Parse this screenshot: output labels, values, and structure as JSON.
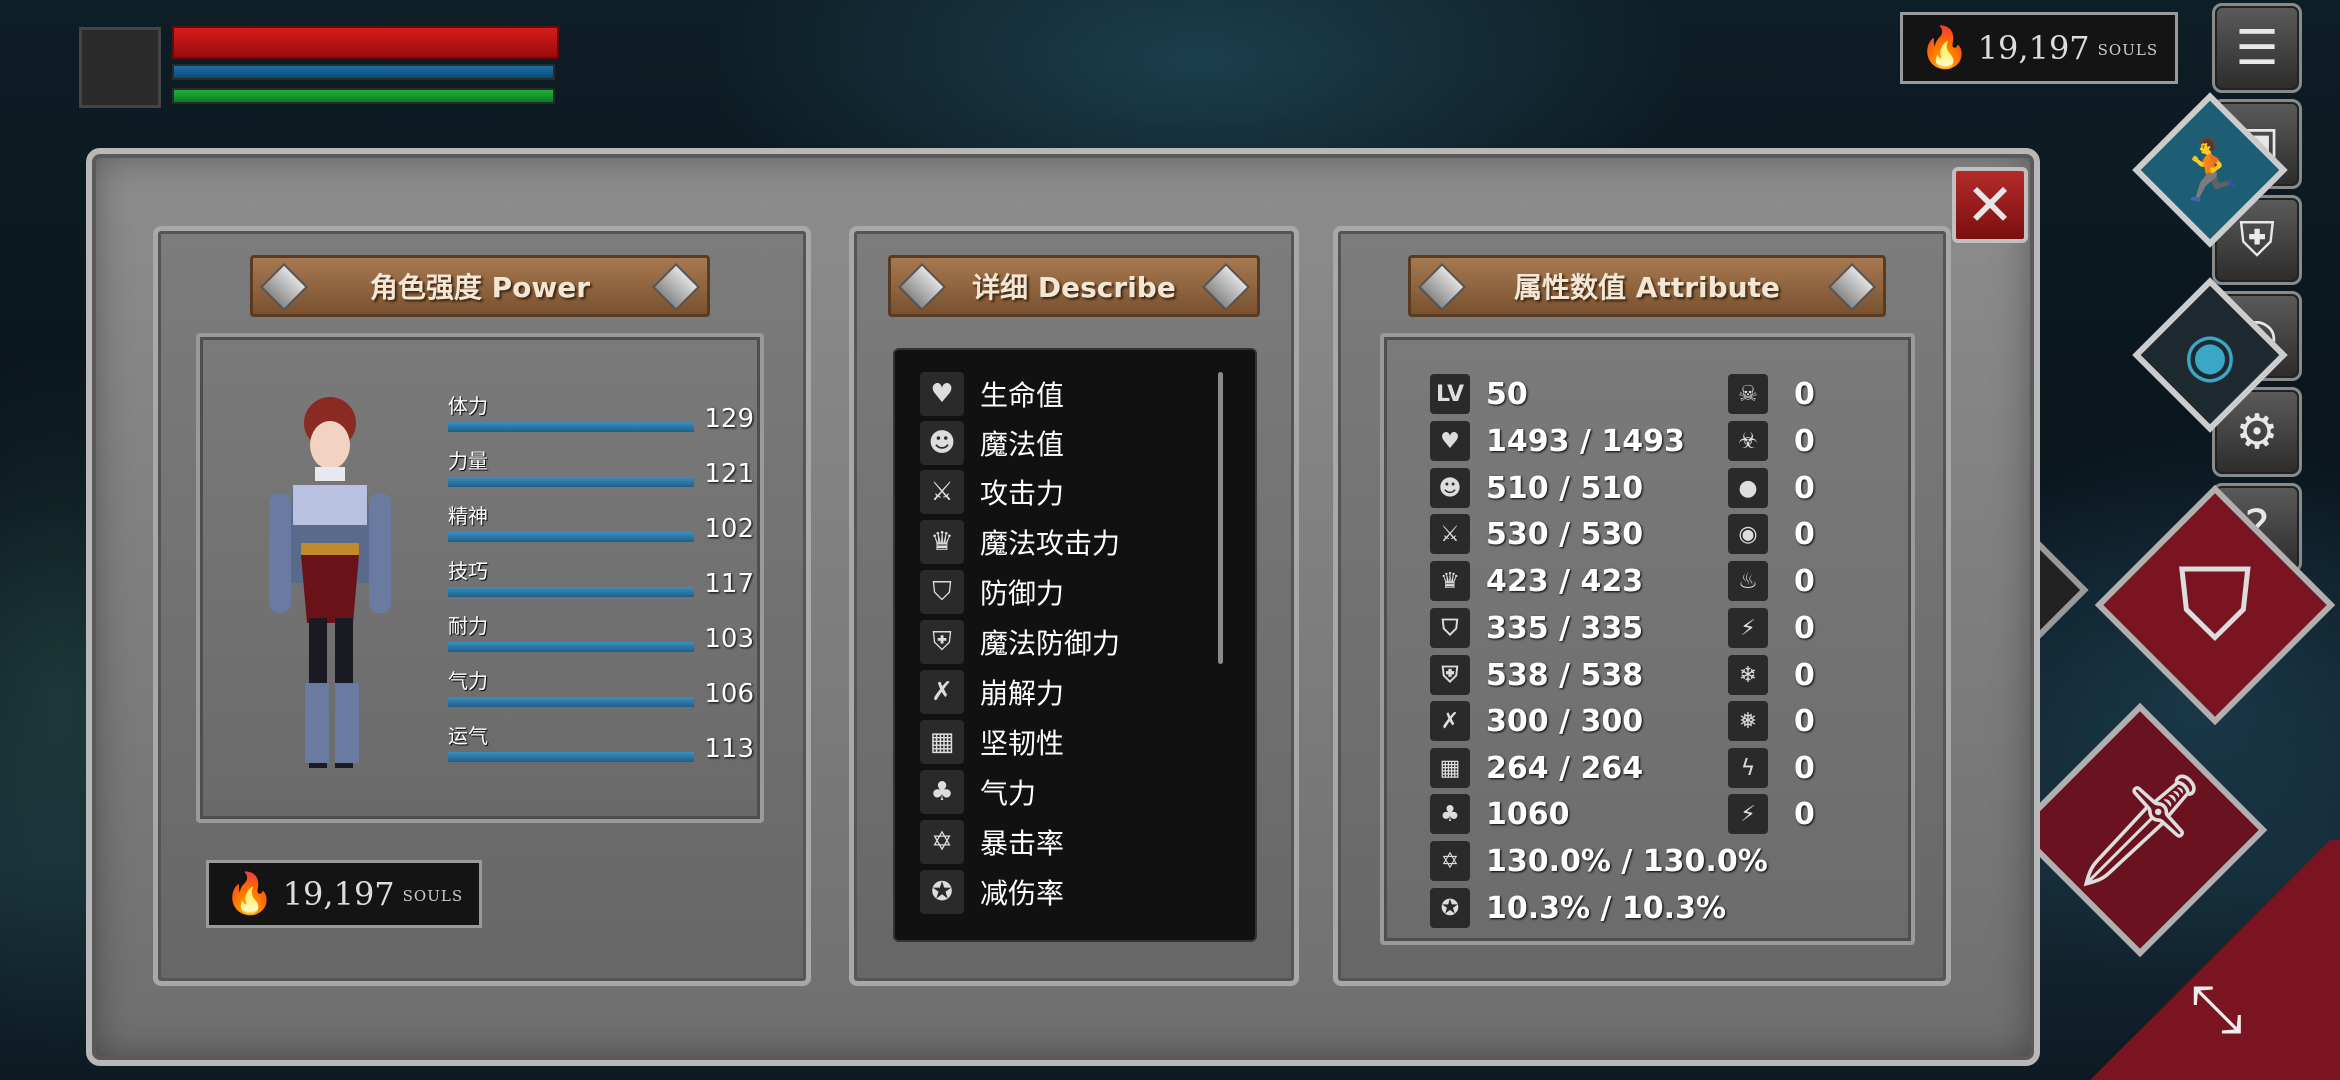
{
  "hud": {
    "souls_amount": "19,197",
    "souls_unit": "souls",
    "hp_fraction": 1.0,
    "mp_fraction": 1.0,
    "stamina_fraction": 1.0
  },
  "power_panel": {
    "title": "角色强度 Power",
    "stats": [
      {
        "label": "体力",
        "value": "129"
      },
      {
        "label": "力量",
        "value": "121"
      },
      {
        "label": "精神",
        "value": "102"
      },
      {
        "label": "技巧",
        "value": "117"
      },
      {
        "label": "耐力",
        "value": "103"
      },
      {
        "label": "气力",
        "value": "106"
      },
      {
        "label": "运气",
        "value": "113"
      }
    ],
    "souls_amount": "19,197",
    "souls_unit": "souls"
  },
  "describe_panel": {
    "title": "详细 Describe",
    "items": [
      {
        "icon": "heart-icon",
        "label": "生命值"
      },
      {
        "icon": "head-icon",
        "label": "魔法值"
      },
      {
        "icon": "sword-icon",
        "label": "攻击力"
      },
      {
        "icon": "magic-book-icon",
        "label": "魔法攻击力"
      },
      {
        "icon": "shield-icon",
        "label": "防御力"
      },
      {
        "icon": "magic-shield-icon",
        "label": "魔法防御力"
      },
      {
        "icon": "crushing-icon",
        "label": "崩解力"
      },
      {
        "icon": "helmet-icon",
        "label": "坚韧性"
      },
      {
        "icon": "lungs-icon",
        "label": "气力"
      },
      {
        "icon": "star-icon",
        "label": "暴击率"
      },
      {
        "icon": "damage-reduction-icon",
        "label": "减伤率"
      }
    ]
  },
  "attribute_panel": {
    "title": "属性数值 Attribute",
    "stats": [
      {
        "icon": "lv-icon",
        "icon_text": "LV",
        "value": "50"
      },
      {
        "icon": "heart-icon",
        "value": "1493 / 1493"
      },
      {
        "icon": "head-icon",
        "value": "510 / 510"
      },
      {
        "icon": "sword-icon",
        "value": "530 / 530"
      },
      {
        "icon": "magic-book-icon",
        "value": "423 / 423"
      },
      {
        "icon": "shield-icon",
        "value": "335 / 335"
      },
      {
        "icon": "magic-shield-icon",
        "value": "538 / 538"
      },
      {
        "icon": "crushing-icon",
        "value": "300 / 300"
      },
      {
        "icon": "helmet-icon",
        "value": "264 / 264"
      },
      {
        "icon": "lungs-icon",
        "value": "1060"
      },
      {
        "icon": "star-icon",
        "value": "130.0% / 130.0%"
      },
      {
        "icon": "damage-reduction-icon",
        "value": "10.3% / 10.3%"
      }
    ],
    "resistances": [
      {
        "icon": "skull-icon",
        "value": "0"
      },
      {
        "icon": "poison-skull-icon",
        "value": "0"
      },
      {
        "icon": "drop-icon",
        "value": "0"
      },
      {
        "icon": "drop-resist-icon",
        "value": "0"
      },
      {
        "icon": "fire-icon",
        "value": "0"
      },
      {
        "icon": "fire-resist-icon",
        "value": "0"
      },
      {
        "icon": "frost-icon",
        "value": "0"
      },
      {
        "icon": "frost-resist-icon",
        "value": "0"
      },
      {
        "icon": "lightning-icon",
        "value": "0"
      },
      {
        "icon": "lightning-resist-icon",
        "value": "0"
      }
    ]
  },
  "colors": {
    "hp": "#d41c1c",
    "mp": "#1a6ea6",
    "stamina": "#1eb03a",
    "panel_stone": "#7c7c7c",
    "plank_wood": "#a67850",
    "stat_bar": "#3a8fc0"
  }
}
